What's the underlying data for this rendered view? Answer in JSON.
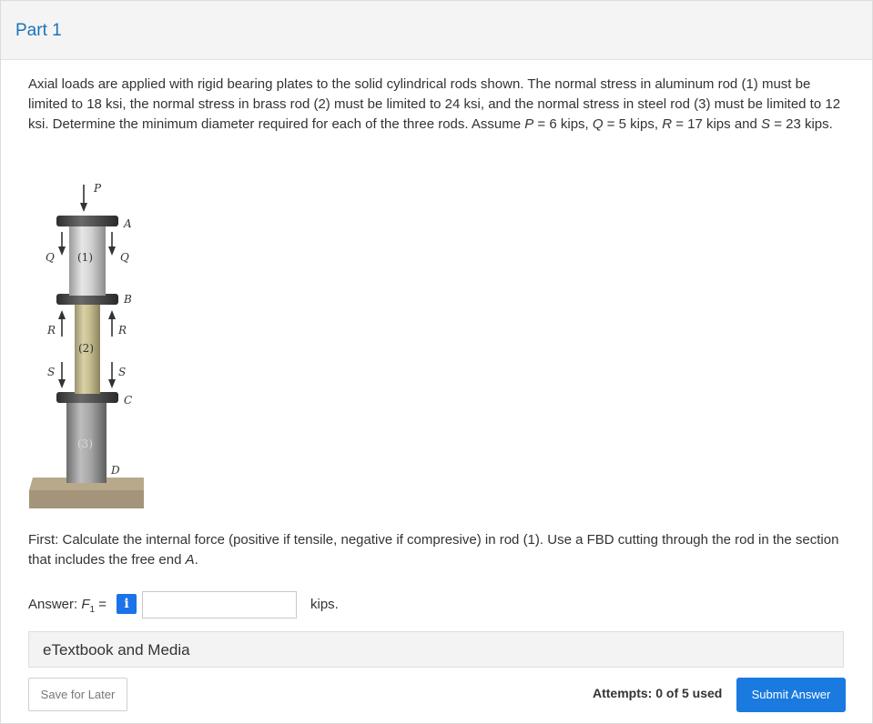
{
  "part": {
    "title": "Part 1"
  },
  "problem": {
    "text_before_P": "Axial loads are applied with rigid bearing plates to the solid cylindrical rods shown. The normal stress in aluminum rod (1) must be limited to 18 ksi, the normal stress in brass rod (2) must be limited to 24 ksi, and the normal stress in steel rod (3) must be limited to 12 ksi. Determine the minimum diameter required for each of the three rods. Assume ",
    "var_P": "P",
    "eq_P": " = 6 kips, ",
    "var_Q": "Q",
    "eq_Q": " = 5 kips, ",
    "var_R": "R",
    "eq_R": " = 17 kips and ",
    "var_S": "S",
    "eq_S": " = 23 kips."
  },
  "figure": {
    "labels": {
      "P": "P",
      "A": "A",
      "Q_left": "Q",
      "Q_right": "Q",
      "rod1": "(1)",
      "B": "B",
      "R_left": "R",
      "R_right": "R",
      "rod2": "(2)",
      "S_left": "S",
      "S_right": "S",
      "C": "C",
      "rod3": "(3)",
      "D": "D"
    }
  },
  "question": {
    "text": "First: Calculate the internal force (positive if tensile, negative if compresive) in rod (1). Use a FBD cutting through the rod in the section that includes the free end ",
    "end_var": "A",
    "end_punct": "."
  },
  "answer": {
    "label_prefix": "Answer: ",
    "var": "F",
    "sub": "1",
    "eq": " =",
    "info_glyph": "i",
    "value": "",
    "placeholder": "",
    "units": "kips."
  },
  "etextbook": {
    "label": "eTextbook and Media"
  },
  "footer": {
    "save_label": "Save for Later",
    "attempts": "Attempts: 0 of 5 used",
    "submit_label": "Submit Answer"
  },
  "colors": {
    "link_blue": "#1a73b8",
    "button_blue": "#1a7ae0",
    "info_blue": "#1a73e8"
  },
  "icons": {
    "info": "info-icon"
  }
}
